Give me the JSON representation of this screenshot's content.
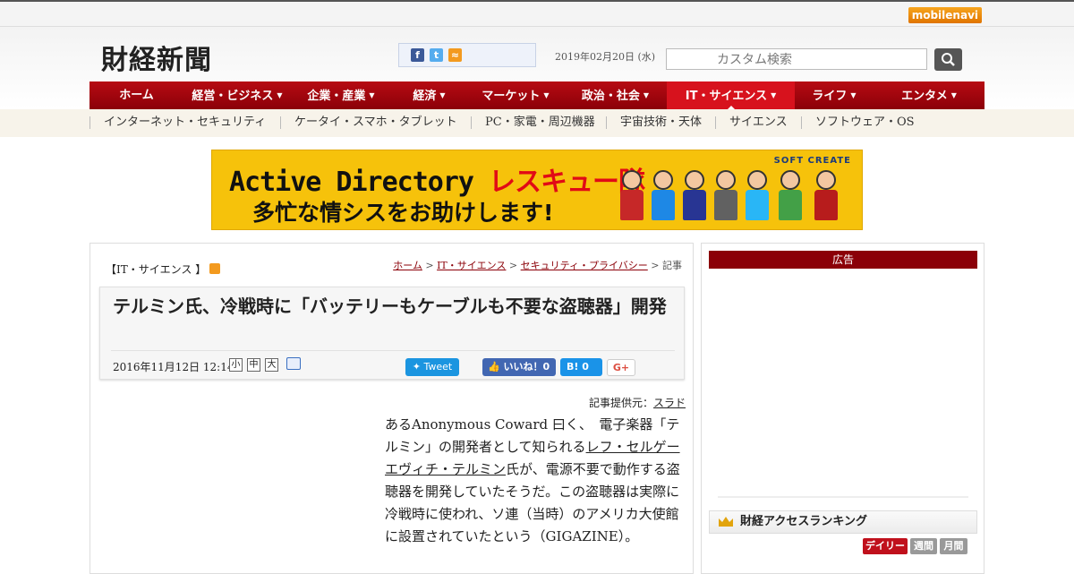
{
  "topbar": {
    "mobile_brand": "mobile",
    "mobile_brand2": "navi"
  },
  "header": {
    "logo": "財経新聞",
    "date": "2019年02月20日 (水)",
    "search_placeholder": "カスタム検索"
  },
  "nav": {
    "items": [
      {
        "label": "ホーム",
        "caret": false
      },
      {
        "label": "経営・ビジネス",
        "caret": true
      },
      {
        "label": "企業・産業",
        "caret": true
      },
      {
        "label": "経済",
        "caret": true
      },
      {
        "label": "マーケット",
        "caret": true
      },
      {
        "label": "政治・社会",
        "caret": true
      },
      {
        "label": "IT・サイエンス",
        "caret": true,
        "active": true
      },
      {
        "label": "ライフ",
        "caret": true
      },
      {
        "label": "エンタメ",
        "caret": true
      }
    ],
    "sub_items": [
      "インターネット・セキュリティ",
      "ケータイ・スマホ・タブレット",
      "PC・家電・周辺機器",
      "宇宙技術・天体",
      "サイエンス",
      "ソフトウェア・OS"
    ]
  },
  "banner": {
    "line1_a": "Active Directory",
    "line1_b": "レスキュー隊",
    "line2": "多忙な情シスをお助けします!",
    "brand": "SOFT CREATE"
  },
  "article": {
    "category": "【IT・サイエンス 】",
    "breadcrumb": {
      "home": "ホーム",
      "sep1": " > ",
      "cat": "IT・サイエンス",
      "sep2": " > ",
      "sub": "セキュリティ・プライバシー",
      "tail": " > 記事"
    },
    "title": "テルミン氏、冷戦時に「バッテリーもケーブルも不要な盗聴器」開発",
    "date": "2016年11月12日 12:14",
    "size_small": "小",
    "size_mid": "中",
    "size_large": "大",
    "tweet": "Tweet",
    "like": "いいね！",
    "like_count": "0",
    "hatena": "B!",
    "hatena_count": "0",
    "gplus": "G+",
    "source_label": "記事提供元：",
    "source_link": "スラド",
    "body_1": "あるAnonymous Coward 曰く、　電子楽器「テルミン」の開発者として知られる",
    "body_link": "レフ・セルゲーエヴィチ・テルミン",
    "body_2": "氏が、電源不要で動作する盗聴器を開発していたそうだ。この盗聴器は実際に冷戦時に使われ、ソ連（当時）のアメリカ大使館に設置されていたという（GIGAZINE）。"
  },
  "sidebar": {
    "ad_label": "広告",
    "ranking_title": "財経アクセスランキング",
    "tabs": [
      {
        "label": "デイリー",
        "color": "#c0101c"
      },
      {
        "label": "週間",
        "color": "#999999"
      },
      {
        "label": "月間",
        "color": "#999999"
      }
    ]
  },
  "colors": {
    "brand_red": "#8b0008",
    "accent_red": "#d7121d",
    "banner_yellow": "#f6c20b"
  }
}
